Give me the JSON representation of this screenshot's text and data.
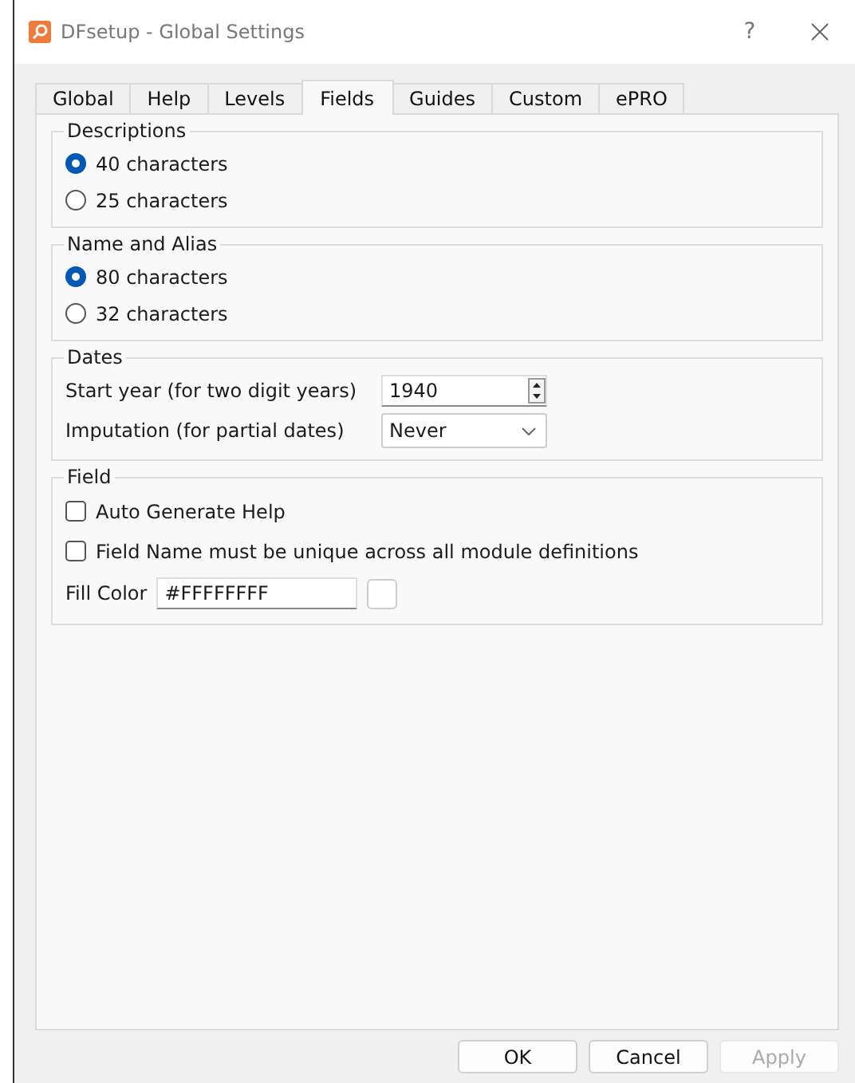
{
  "window": {
    "title": "DFsetup - Global Settings",
    "help": "?"
  },
  "tabs": [
    {
      "label": "Global",
      "selected": false
    },
    {
      "label": "Help",
      "selected": false
    },
    {
      "label": "Levels",
      "selected": false
    },
    {
      "label": "Fields",
      "selected": true
    },
    {
      "label": "Guides",
      "selected": false
    },
    {
      "label": "Custom",
      "selected": false
    },
    {
      "label": "ePRO",
      "selected": false
    }
  ],
  "groups": [
    {
      "title": "Descriptions",
      "items": [
        {
          "kind": "radio",
          "label": "40 characters",
          "selected": true
        },
        {
          "kind": "radio",
          "label": "25 characters",
          "selected": false
        }
      ]
    },
    {
      "title": "Name and Alias",
      "items": [
        {
          "kind": "radio",
          "label": "80 characters",
          "selected": true
        },
        {
          "kind": "radio",
          "label": "32 characters",
          "selected": false
        }
      ]
    },
    {
      "title": "Dates",
      "items": [
        {
          "kind": "spin",
          "label": "Start year (for two digit years)",
          "value": "1940"
        },
        {
          "kind": "select",
          "label": "Imputation (for partial dates)",
          "value": "Never"
        }
      ]
    },
    {
      "title": "Field",
      "items": [
        {
          "kind": "checkbox",
          "label": "Auto Generate Help",
          "checked": false
        },
        {
          "kind": "checkbox",
          "label": "Field Name must be unique across all module definitions",
          "checked": false
        },
        {
          "kind": "color",
          "label": "Fill Color",
          "value": "#FFFFFFFF",
          "color": "#ffffff"
        }
      ]
    }
  ],
  "buttons": [
    {
      "label": "OK",
      "disabled": false
    },
    {
      "label": "Cancel",
      "disabled": false
    },
    {
      "label": "Apply",
      "disabled": true
    }
  ]
}
